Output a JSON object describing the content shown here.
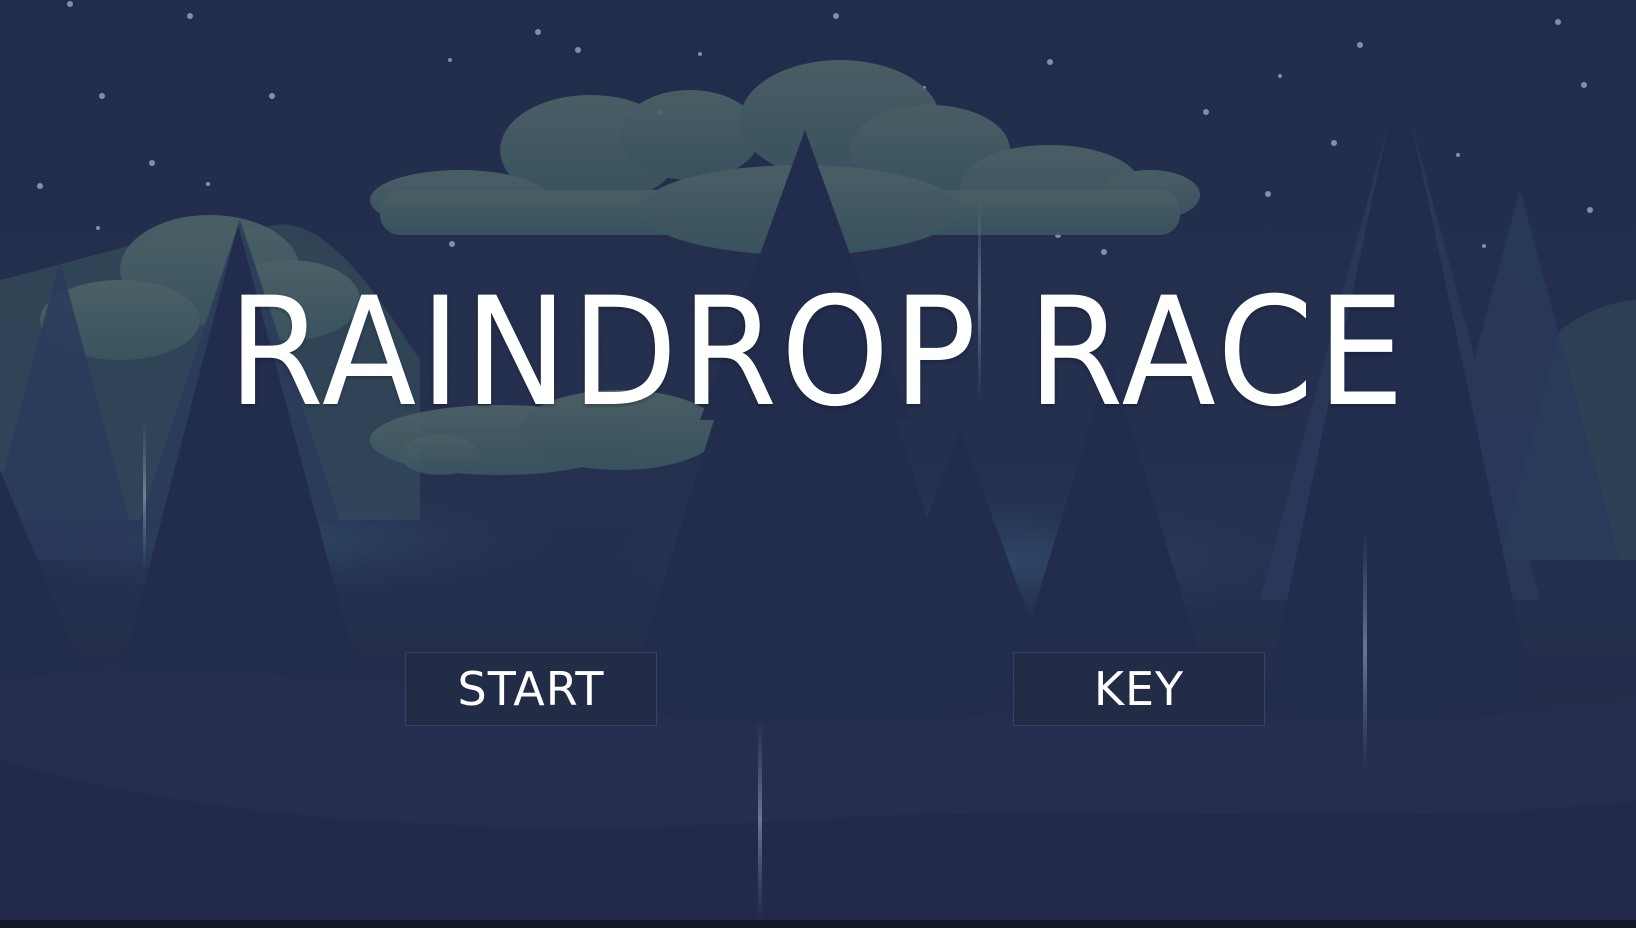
{
  "game": {
    "title": "RAINDROP RACE"
  },
  "menu": {
    "start_label": "START",
    "key_label": "KEY"
  },
  "colors": {
    "sky": "#222c4b",
    "cloud": "#3f5a62",
    "tree_dark": "#1f2948",
    "tree_mid": "#26355a",
    "ground_glow": "#2c4a6e",
    "text": "#ffffff",
    "button_bg": "#222c47"
  }
}
